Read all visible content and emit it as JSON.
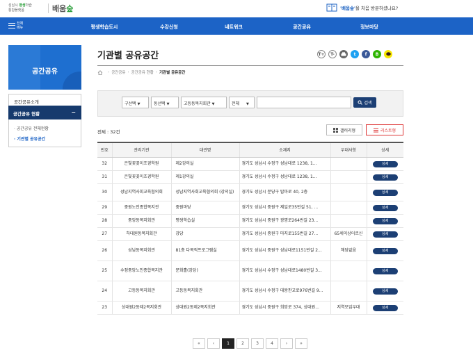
{
  "header": {
    "logo_small_line1": "성남시",
    "logo_small_accent": "평생",
    "logo_small_rest": "학습",
    "logo_small_line2": "통합플랫폼",
    "logo_big_a": "배움",
    "logo_big_b": "숲",
    "visit_brand": "'배움숲'",
    "visit_text": "을 처음 방문하셨나요?"
  },
  "gnb": {
    "menu_label_1": "전체",
    "menu_label_2": "메뉴",
    "items": [
      "평생학습도시",
      "수강신청",
      "네트워크",
      "공간공유",
      "정보마당"
    ]
  },
  "lnb": {
    "title": "공간공유",
    "item1": "공간공유소개",
    "item2": "공간공유 현황",
    "item2_toggle": "−",
    "sub": [
      "공간공유 전체현황",
      "기관별 공유공간"
    ]
  },
  "page": {
    "title": "기관별 공유공간",
    "share": [
      "T+",
      "T-"
    ],
    "breadcrumb": [
      "공간공유",
      "공간공유 현황",
      "기관별 공유공간"
    ]
  },
  "search": {
    "sel1": "구선택",
    "sel2": "동선택",
    "sel3": "고등동복지회관",
    "sel4": "전체",
    "input_value": "",
    "button": "검색"
  },
  "list": {
    "total": "전체 : 32건",
    "gallery_btn": "갤러리형",
    "list_btn": "리스트형",
    "headers": [
      "번호",
      "관리기관",
      "대관명",
      "소재지",
      "우대사항",
      "상세"
    ],
    "detail_label": "상세",
    "rows": [
      {
        "no": "32",
        "org": "은빛꽃꽂이조경학원",
        "name": "제2강의실",
        "addr": "경기도 성남시 수정구 성남대로 1238, 1...",
        "pref": ""
      },
      {
        "no": "31",
        "org": "은빛꽃꽂이조경학원",
        "name": "제1강의실",
        "addr": "경기도 성남시 수정구 성남대로 1238, 1...",
        "pref": ""
      },
      {
        "no": "30",
        "org": "성남지역사회교육협의회",
        "name": "성남지역사회교육협의회 (강의실)",
        "addr": "경기도 성남시 분당구 탑마로 40, 2층",
        "pref": ""
      },
      {
        "no": "29",
        "org": "중원노인종합복지관",
        "name": "중원마당",
        "addr": "경기도 성남시 중원구 제일로35번길 51, ...",
        "pref": ""
      },
      {
        "no": "28",
        "org": "중앙동복지회관",
        "name": "평생학습실",
        "addr": "경기도 성남시 중원구 광명로264번길 23...",
        "pref": ""
      },
      {
        "no": "27",
        "org": "하대원동복지회관",
        "name": "강당",
        "addr": "경기도 성남시 중원구 마지로155번길 27...",
        "pref": "65세이상어르신"
      },
      {
        "no": "26",
        "org": "성남동복지회관",
        "name": "81층 다목적프로그램실",
        "addr": "경기도 성남시 중원구 성남대로1151번길 2...",
        "pref": "해당없음"
      },
      {
        "no": "25",
        "org": "수정중앙노인종합복지관",
        "name": "문화홀(강당)",
        "addr": "경기도 성남시 수정구 성남대로1480번길 3...",
        "pref": ""
      },
      {
        "no": "24",
        "org": "고등동복지회관",
        "name": "고등동복지회관",
        "addr": "경기도 성남시 수정구 대왕판교로976번길 9...",
        "pref": ""
      },
      {
        "no": "23",
        "org": "상대원2동제2복지회관",
        "name": "상대원2동제2복지회관",
        "addr": "경기도 성남시 중원구 희망로 374, 상대원...",
        "pref": "지역모임우대"
      }
    ]
  },
  "pager": {
    "first": "«",
    "prev": "‹",
    "pages": [
      "1",
      "2",
      "3",
      "4"
    ],
    "next": "›",
    "last": "»"
  },
  "colors": {
    "primary": "#1c63c6",
    "navy": "#163a6d",
    "red": "#d33"
  }
}
